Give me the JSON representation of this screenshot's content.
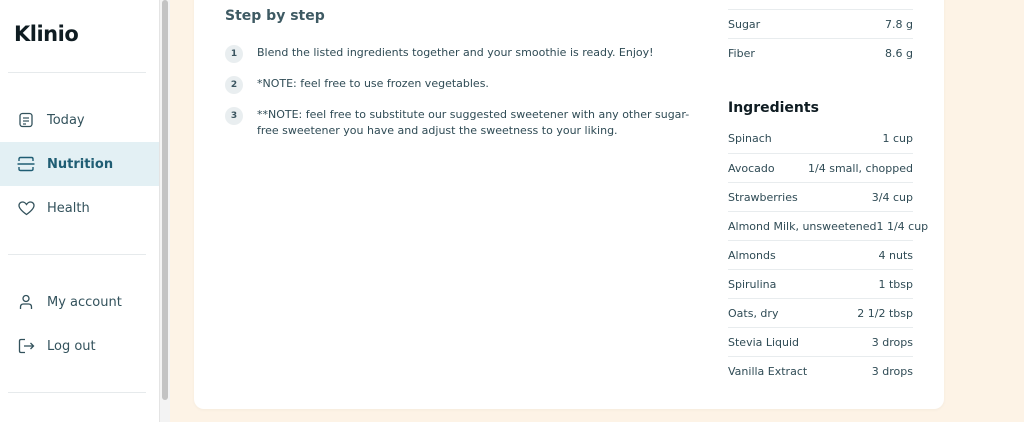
{
  "app": {
    "logo": "Klinio"
  },
  "sidebar": {
    "items": [
      {
        "label": "Today",
        "icon": "document-icon"
      },
      {
        "label": "Nutrition",
        "icon": "fork-knife-icon",
        "active": true
      },
      {
        "label": "Health",
        "icon": "heart-icon"
      },
      {
        "label": "My account",
        "icon": "user-icon"
      },
      {
        "label": "Log out",
        "icon": "logout-icon"
      }
    ]
  },
  "steps": {
    "title": "Step by step",
    "items": [
      {
        "num": "1",
        "text": "Blend the listed ingredients together and your smoothie is ready. Enjoy!"
      },
      {
        "num": "2",
        "text": "*NOTE: feel free to use frozen vegetables."
      },
      {
        "num": "3",
        "text": "**NOTE: feel free to substitute our suggested sweetener with any other sugar-free sweetener you have and adjust the sweetness to your liking."
      }
    ]
  },
  "nutrition": [
    {
      "name": "Sugar",
      "value": "7.8 g"
    },
    {
      "name": "Fiber",
      "value": "8.6 g"
    }
  ],
  "ingredients": {
    "title": "Ingredients",
    "items": [
      {
        "name": "Spinach",
        "value": "1 cup"
      },
      {
        "name": "Avocado",
        "value": "1/4 small, chopped"
      },
      {
        "name": "Strawberries",
        "value": "3/4 cup"
      },
      {
        "name": "Almond Milk, unsweetened",
        "value": "1 1/4 cup"
      },
      {
        "name": "Almonds",
        "value": "4 nuts"
      },
      {
        "name": "Spirulina",
        "value": "1 tbsp"
      },
      {
        "name": "Oats, dry",
        "value": "2 1/2 tbsp"
      },
      {
        "name": "Stevia Liquid",
        "value": "3 drops"
      },
      {
        "name": "Vanilla Extract",
        "value": "3 drops"
      }
    ]
  },
  "colors": {
    "accent": "#1f5d73",
    "active_bg": "#e3f0f4",
    "page_bg": "#fdf3e6"
  }
}
